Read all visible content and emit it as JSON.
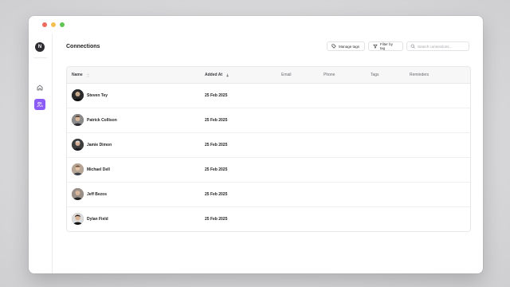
{
  "window": {
    "traffic_lights": [
      "close",
      "minimize",
      "maximize"
    ]
  },
  "sidebar": {
    "user_initial": "N",
    "items": [
      {
        "icon": "home-icon"
      },
      {
        "icon": "people-icon",
        "active": true,
        "accent": "#8b5cf6"
      }
    ]
  },
  "header": {
    "title": "Connections",
    "manage_tags_label": "Manage tags",
    "filter_by_tag_label": "Filter by tag",
    "search_placeholder": "Search connections..."
  },
  "table": {
    "columns": [
      "Name",
      "Added At",
      "Email",
      "Phone",
      "Tags",
      "Reminders"
    ],
    "rows": [
      {
        "name": "Steven Tey",
        "added_at": "25 Feb 2025",
        "avatar_tone": "#3a3a3a"
      },
      {
        "name": "Patrick Collison",
        "added_at": "25 Feb 2025",
        "avatar_tone": "#6e6258"
      },
      {
        "name": "Jamie Dimon",
        "added_at": "25 Feb 2025",
        "avatar_tone": "#4a4a4a"
      },
      {
        "name": "Michael Dell",
        "added_at": "25 Feb 2025",
        "avatar_tone": "#8a7466"
      },
      {
        "name": "Jeff Bezos",
        "added_at": "25 Feb 2025",
        "avatar_tone": "#7a6c62"
      },
      {
        "name": "Dylan Field",
        "added_at": "25 Feb 2025",
        "avatar_tone": "#2e2e2e"
      }
    ]
  }
}
